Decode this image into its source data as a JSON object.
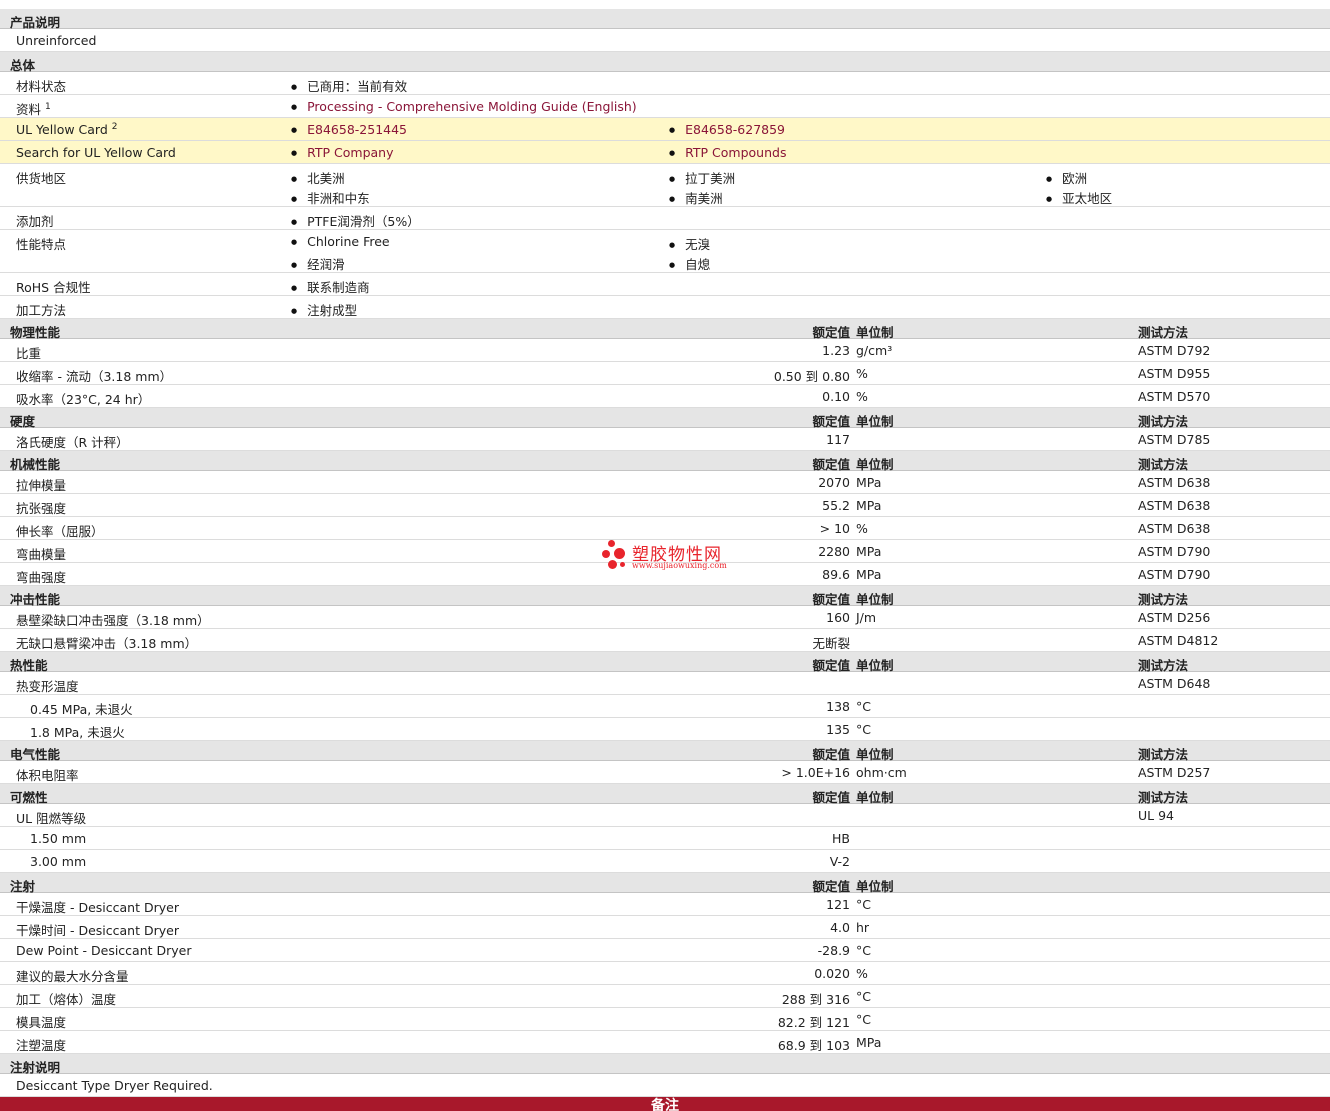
{
  "product_desc": {
    "title": "产品说明",
    "text": "Unreinforced"
  },
  "general": {
    "title": "总体",
    "material_status": {
      "label": "材料状态",
      "value": "已商用：当前有效"
    },
    "literature": {
      "label": "资料",
      "sup": "1",
      "value": "Processing - Comprehensive Molding Guide (English)"
    },
    "ul_yellow_card": {
      "label": "UL Yellow Card",
      "sup": "2",
      "v1": "E84658-251445",
      "v2": "E84658-627859"
    },
    "search_ul": {
      "label": "Search for UL Yellow Card",
      "v1": "RTP Company",
      "v2": "RTP Compounds"
    },
    "availability": {
      "label": "供货地区",
      "v1": "北美洲",
      "v2": "拉丁美洲",
      "v3": "欧洲",
      "v4": "非洲和中东",
      "v5": "南美洲",
      "v6": "亚太地区"
    },
    "additive": {
      "label": "添加剂",
      "value": "PTFE润滑剂（5%）"
    },
    "features": {
      "label": "性能特点",
      "v1": "Chlorine Free",
      "v2": "无溴",
      "v3": "经润滑",
      "v4": "自熄"
    },
    "rohs": {
      "label": "RoHS 合规性",
      "value": "联系制造商"
    },
    "processing": {
      "label": "加工方法",
      "value": "注射成型"
    }
  },
  "col_headers": {
    "value": "额定值",
    "unit": "单位制",
    "method": "测试方法"
  },
  "physical": {
    "title": "物理性能",
    "rows": [
      {
        "label": "比重",
        "value": "1.23",
        "unit": "g/cm³",
        "method": "ASTM D792"
      },
      {
        "label": "收缩率  - 流动（3.18 mm）",
        "value": "0.50 到  0.80",
        "unit": "%",
        "method": "ASTM D955"
      },
      {
        "label": "吸水率（23°C, 24 hr）",
        "value": "0.10",
        "unit": "%",
        "method": "ASTM D570"
      }
    ]
  },
  "hardness": {
    "title": "硬度",
    "rows": [
      {
        "label": "洛氏硬度（R 计秤）",
        "value": "117",
        "unit": "",
        "method": "ASTM D785"
      }
    ]
  },
  "mechanical": {
    "title": "机械性能",
    "rows": [
      {
        "label": "拉伸模量",
        "value": "2070",
        "unit": "MPa",
        "method": "ASTM D638"
      },
      {
        "label": "抗张强度",
        "value": "55.2",
        "unit": "MPa",
        "method": "ASTM D638"
      },
      {
        "label": "伸长率（屈服）",
        "value": "> 10",
        "unit": "%",
        "method": "ASTM D638"
      },
      {
        "label": "弯曲模量",
        "value": "2280",
        "unit": "MPa",
        "method": "ASTM D790"
      },
      {
        "label": "弯曲强度",
        "value": "89.6",
        "unit": "MPa",
        "method": "ASTM D790"
      }
    ]
  },
  "impact": {
    "title": "冲击性能",
    "rows": [
      {
        "label": "悬壁梁缺口冲击强度（3.18 mm）",
        "value": "160",
        "unit": "J/m",
        "method": "ASTM D256"
      },
      {
        "label": "无缺口悬臂梁冲击（3.18 mm）",
        "value": "无断裂",
        "unit": "",
        "method": "ASTM D4812"
      }
    ]
  },
  "thermal": {
    "title": "热性能",
    "hdt_label": "热变形温度",
    "hdt_method": "ASTM D648",
    "rows": [
      {
        "label": "0.45 MPa, 未退火",
        "value": "138",
        "unit": "°C"
      },
      {
        "label": "1.8 MPa, 未退火",
        "value": "135",
        "unit": "°C"
      }
    ]
  },
  "electrical": {
    "title": "电气性能",
    "rows": [
      {
        "label": "体积电阻率",
        "value": "> 1.0E+16",
        "unit": "ohm·cm",
        "method": "ASTM D257"
      }
    ]
  },
  "flammability": {
    "title": "可燃性",
    "ul_label": "UL 阻燃等级",
    "ul_method": "UL 94",
    "rows": [
      {
        "label": "1.50 mm",
        "value": "HB"
      },
      {
        "label": "3.00 mm",
        "value": "V-2"
      }
    ]
  },
  "injection": {
    "title": "注射",
    "rows": [
      {
        "label": "干燥温度  - Desiccant Dryer",
        "value": "121",
        "unit": "°C"
      },
      {
        "label": "干燥时间  - Desiccant Dryer",
        "value": "4.0",
        "unit": "hr"
      },
      {
        "label": "Dew Point - Desiccant Dryer",
        "value": "-28.9",
        "unit": "°C"
      },
      {
        "label": "建议的最大水分含量",
        "value": "0.020",
        "unit": "%"
      },
      {
        "label": "加工（熔体）温度",
        "value": "288 到  316",
        "unit": "°C"
      },
      {
        "label": "模具温度",
        "value": "82.2 到  121",
        "unit": "°C"
      },
      {
        "label": "注塑温度",
        "value": "68.9 到  103",
        "unit": "MPa"
      }
    ]
  },
  "injection_notes": {
    "title": "注射说明",
    "text": "Desiccant Type Dryer Required."
  },
  "footer": {
    "label": "备注"
  },
  "watermark": {
    "main": "塑胶物性网",
    "sub": "www.sujiaowuxing.com"
  },
  "colors": {
    "link": "#8a1538",
    "highlight": "#fff8c8",
    "footer": "#a8182b",
    "watermark": "#e8242c"
  }
}
